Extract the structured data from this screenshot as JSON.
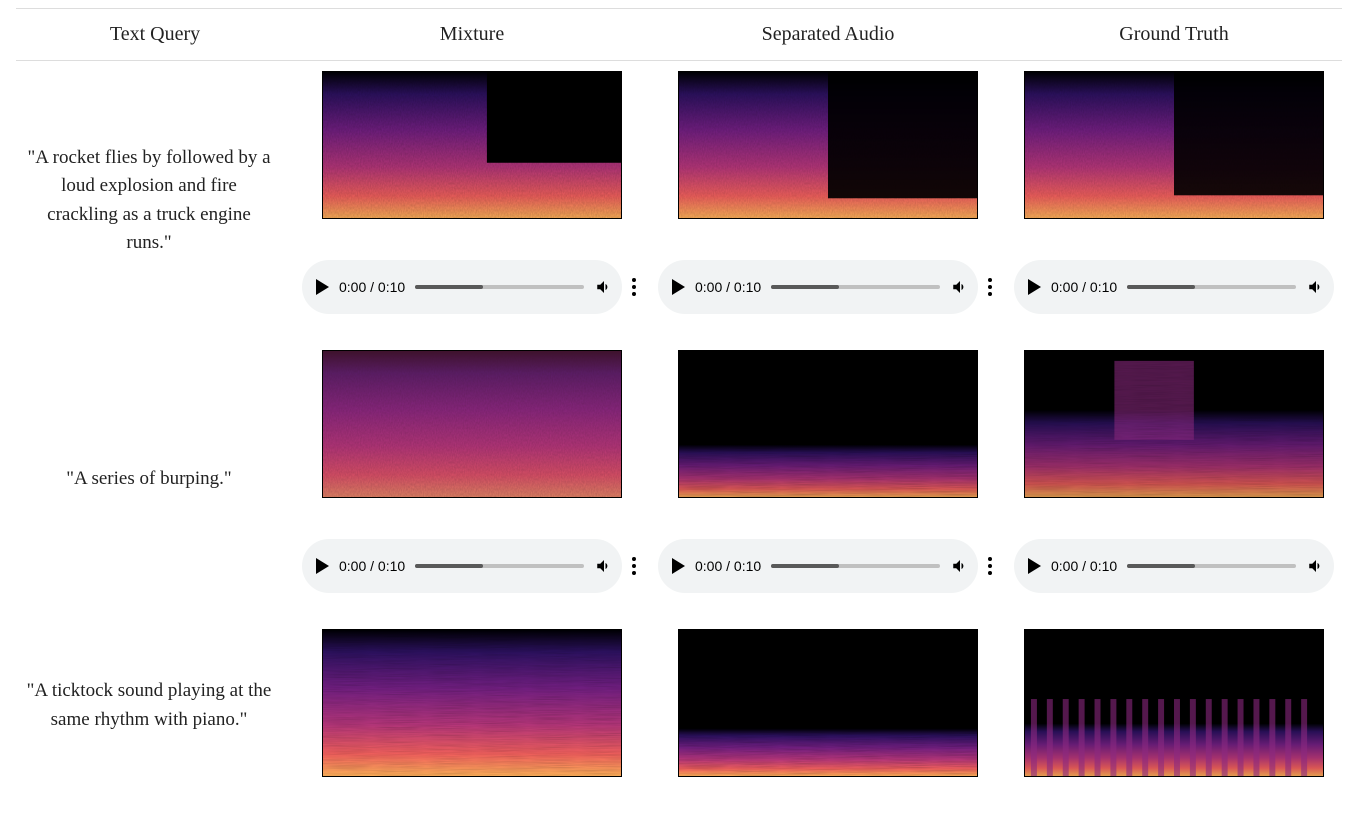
{
  "headers": {
    "query": "Text Query",
    "mixture": "Mixture",
    "separated": "Separated Audio",
    "ground_truth": "Ground Truth"
  },
  "rows": [
    {
      "query": "\"A rocket flies by followed by a loud explosion and fire crackling as a truck engine runs.\"",
      "spectrograms": {
        "mixture": "rocket-mix",
        "separated": "rocket-sep",
        "ground_truth": "rocket-gt"
      },
      "player": {
        "current": "0:00",
        "duration": "0:10"
      }
    },
    {
      "query": "\"A series of burping.\"",
      "spectrograms": {
        "mixture": "burp-mix",
        "separated": "burp-sep",
        "ground_truth": "burp-gt"
      },
      "player": {
        "current": "0:00",
        "duration": "0:10"
      }
    },
    {
      "query": "\"A ticktock sound playing at the same rhythm with piano.\"",
      "spectrograms": {
        "mixture": "tick-mix",
        "separated": "tick-sep",
        "ground_truth": "tick-gt"
      },
      "player": {
        "current": "0:00",
        "duration": "0:10"
      }
    }
  ]
}
